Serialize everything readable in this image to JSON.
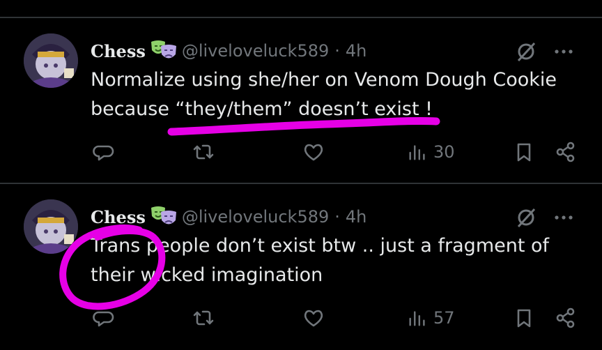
{
  "posts": [
    {
      "display_name": "Chess",
      "handle": "@liveloveluck589",
      "separator": "·",
      "time": "4h",
      "text_lines": [
        "Normalize using she/her on Venom Dough Cookie",
        "because “they/them” doesn’t exist !"
      ],
      "views": "30"
    },
    {
      "display_name": "Chess",
      "handle": "@liveloveluck589",
      "separator": "·",
      "time": "4h",
      "text_lines": [
        "Trans people don’t exist btw .. just a fragment of",
        "their wicked imagination"
      ],
      "views": "57"
    }
  ],
  "icons": {
    "header": [
      "theater-masks-emoji-icon",
      "grok-icon",
      "more-icon"
    ],
    "actions": [
      "reply-icon",
      "repost-icon",
      "like-icon",
      "views-icon",
      "bookmark-icon",
      "share-icon"
    ]
  },
  "colors": {
    "background": "#000000",
    "text": "#e7e9ea",
    "secondary": "#71767b",
    "divider": "#2f3336",
    "annotation": "#e600e6"
  }
}
